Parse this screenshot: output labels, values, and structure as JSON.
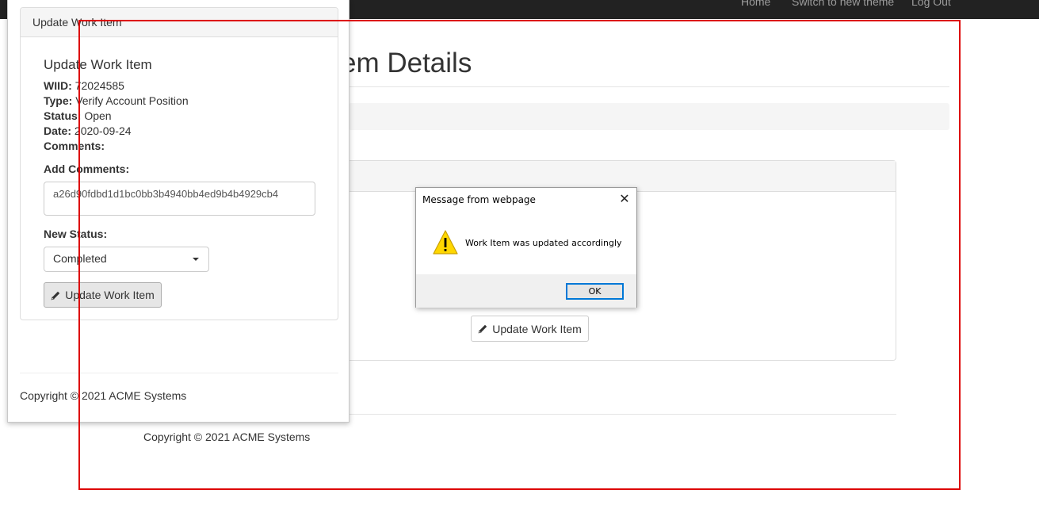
{
  "navbar": {
    "links": [
      "Home",
      "Switch to new theme",
      "Log Out"
    ]
  },
  "background_page": {
    "title_fragment": "em Details",
    "update_button_label": "Update Work Item",
    "copyright": "Copyright © 2021 ACME Systems"
  },
  "popup": {
    "panel_heading": "Update Work Item",
    "title": "Update Work Item",
    "fields": {
      "wiid_label": "WIID:",
      "wiid_value": "72024585",
      "type_label": "Type:",
      "type_value": "Verify Account Position",
      "status_label": "Status:",
      "status_value": "Open",
      "date_label": "Date:",
      "date_value": "2020-09-24",
      "comments_label": "Comments:"
    },
    "add_comments_label": "Add Comments:",
    "comment_value": "a26d90fdbd1d1bc0bb3b4940bb4ed9b4b4929cb4",
    "new_status_label": "New Status:",
    "new_status_value": "Completed",
    "update_button_label": "Update Work Item",
    "copyright": "Copyright © 2021 ACME Systems"
  },
  "dialog": {
    "title": "Message from webpage",
    "message": "Work Item was updated accordingly",
    "ok_label": "OK",
    "icon": "warning-icon"
  },
  "colors": {
    "navbar_bg": "#222222",
    "highlight_frame": "#dd0000",
    "ok_focus": "#0078d7"
  }
}
